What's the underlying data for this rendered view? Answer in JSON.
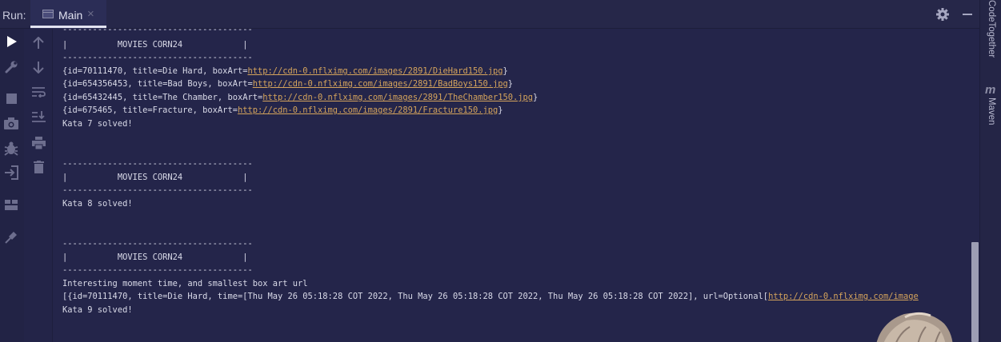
{
  "header": {
    "run_label": "Run:",
    "tab_label": "Main",
    "tab_close": "×"
  },
  "right_panel": {
    "tool1": "CodeTogether",
    "tool2": "Maven"
  },
  "console": {
    "lines": [
      "--------------------------------------",
      "|          MOVIES CORN24            |",
      "--------------------------------------",
      "Kata 7 solved!",
      "--------------------------------------",
      "|          MOVIES CORN24            |",
      "--------------------------------------",
      "Kata 8 solved!",
      "--------------------------------------",
      "|          MOVIES CORN24            |",
      "--------------------------------------",
      "Interesting moment time, and smallest box art url",
      "Kata 9 solved!"
    ],
    "movies": [
      {
        "prefix": "{id=70111470, title=Die Hard, boxArt=",
        "url": "http://cdn-0.nflximg.com/images/2891/DieHard150.jpg",
        "suffix": "}"
      },
      {
        "prefix": "{id=654356453, title=Bad Boys, boxArt=",
        "url": "http://cdn-0.nflximg.com/images/2891/BadBoys150.jpg",
        "suffix": "}"
      },
      {
        "prefix": "{id=65432445, title=The Chamber, boxArt=",
        "url": "http://cdn-0.nflximg.com/images/2891/TheChamber150.jpg",
        "suffix": "}"
      },
      {
        "prefix": "{id=675465, title=Fracture, boxArt=",
        "url": "http://cdn-0.nflximg.com/images/2891/Fracture150.jpg",
        "suffix": "}"
      }
    ],
    "kata9_result": {
      "prefix": "[{id=70111470, title=Die Hard, time=[Thu May 26 05:18:28 COT 2022, Thu May 26 05:18:28 COT 2022, Thu May 26 05:18:28 COT 2022], url=Optional[",
      "url": "http://cdn-0.nflximg.com/image"
    }
  },
  "icons": {
    "left_strip": [
      "run-icon",
      "wrench-icon",
      "stop-icon",
      "camera-icon",
      "bug-icon",
      "login-icon",
      "layout-icon",
      "pin-icon"
    ],
    "second_strip": [
      "up-arrow-icon",
      "down-arrow-icon",
      "soft-wrap-icon",
      "scroll-to-end-icon",
      "print-icon",
      "trash-icon"
    ]
  },
  "colors": {
    "background": "#24254a",
    "link": "#d5a45c",
    "run_icon": "#ffffff"
  }
}
